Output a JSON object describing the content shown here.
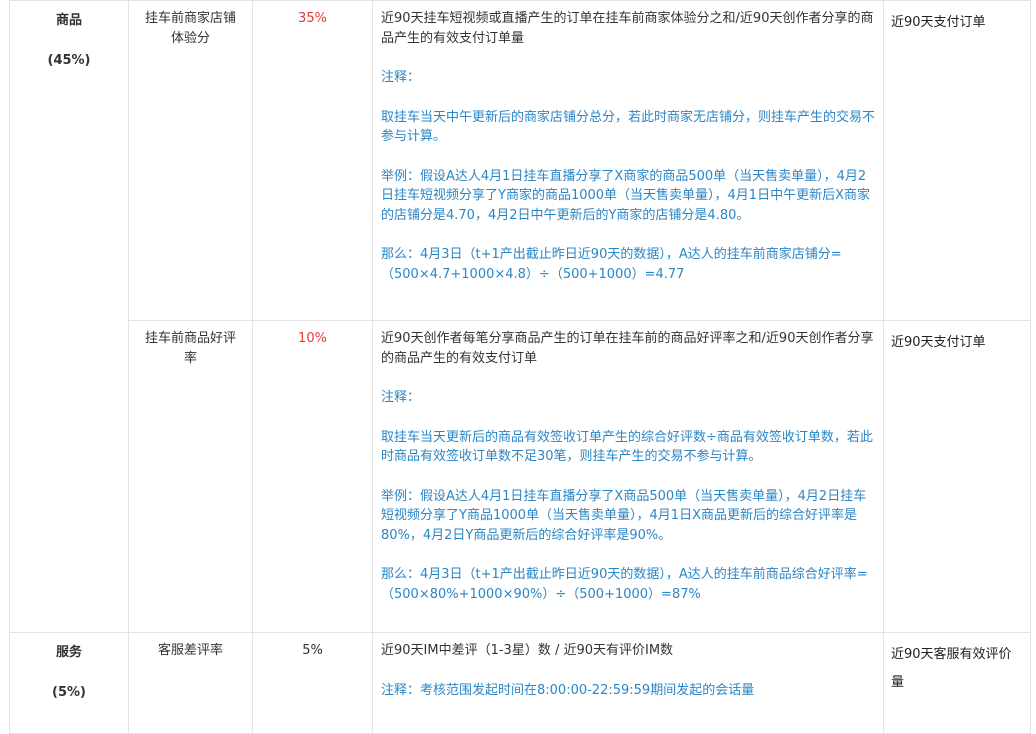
{
  "rows": [
    {
      "category": "商品",
      "category_weight": "(45%)",
      "indicator": "挂车前商家店铺体验分",
      "weight": "35%",
      "main": "近90天挂车短视频或直播产生的订单在挂车前商家体验分之和/近90天创作者分享的商品产生的有效支付订单量",
      "notes": [
        "注释：",
        "取挂车当天中午更新后的商家店铺分总分，若此时商家无店铺分，则挂车产生的交易不参与计算。",
        "举例：假设A达人4月1日挂车直播分享了X商家的商品500单（当天售卖单量），4月2日挂车短视频分享了Y商家的商品1000单（当天售卖单量），4月1日中午更新后X商家的店铺分是4.70，4月2日中午更新后的Y商家的店铺分是4.80。",
        "那么：4月3日（t+1产出截止昨日近90天的数据），A达人的挂车前商家店铺分=（500×4.7+1000×4.8）÷（500+1000）=4.77"
      ],
      "basis": "近90天支付订单"
    },
    {
      "indicator": "挂车前商品好评率",
      "weight": "10%",
      "main": "近90天创作者每笔分享商品产生的订单在挂车前的商品好评率之和/近90天创作者分享的商品产生的有效支付订单",
      "notes": [
        "注释：",
        "取挂车当天更新后的商品有效签收订单产生的综合好评数÷商品有效签收订单数，若此时商品有效签收订单数不足30笔，则挂车产生的交易不参与计算。",
        "举例：假设A达人4月1日挂车直播分享了X商品500单（当天售卖单量），4月2日挂车短视频分享了Y商品1000单（当天售卖单量），4月1日X商品更新后的综合好评率是80%，4月2日Y商品更新后的综合好评率是90%。",
        "那么：4月3日（t+1产出截止昨日近90天的数据），A达人的挂车前商品综合好评率=（500×80%+1000×90%）÷（500+1000）=87%"
      ],
      "basis": "近90天支付订单"
    },
    {
      "category": "服务",
      "category_weight": "(5%)",
      "indicator": "客服差评率",
      "weight": "5%",
      "main": "近90天IM中差评（1-3星）数 / 近90天有评价IM数",
      "notes": [
        "注释：考核范围发起时间在8:00:00-22:59:59期间发起的会话量"
      ],
      "basis": "近90天客服有效评价量"
    }
  ]
}
